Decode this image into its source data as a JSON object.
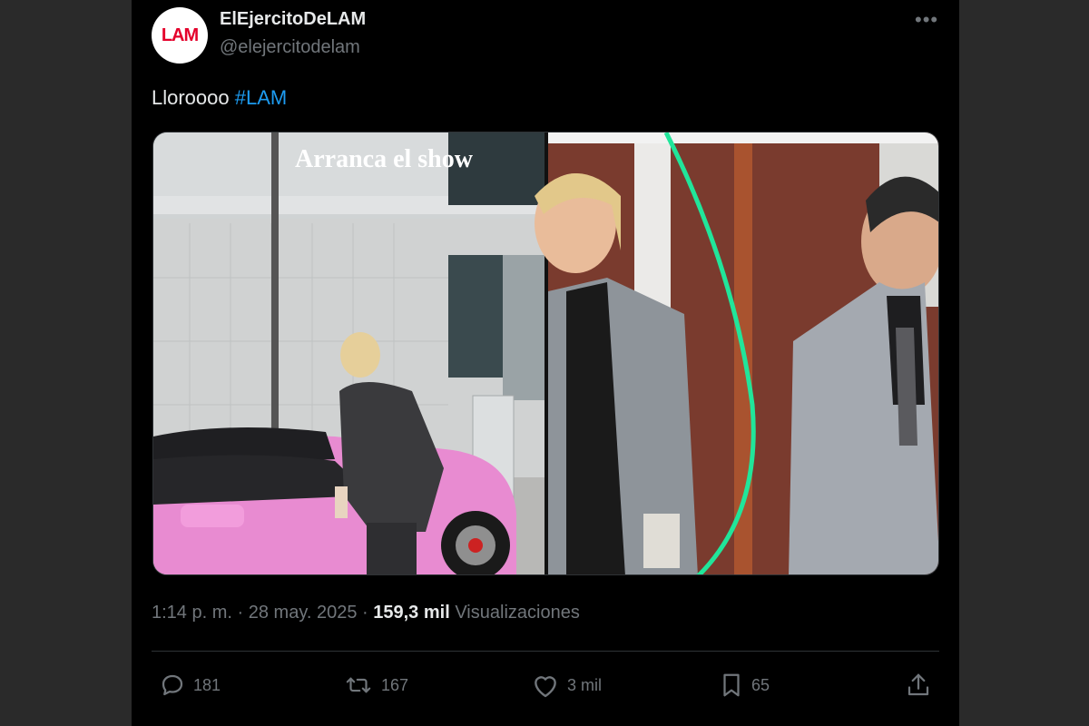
{
  "author": {
    "avatar_text": "LAM",
    "display_name": "ElEjercitoDeLAM",
    "handle": "@elejercitodelam"
  },
  "tweet": {
    "text": "Lloroooo",
    "hashtag": "#LAM"
  },
  "media": {
    "overlay_text": "Arranca el show"
  },
  "meta": {
    "time": "1:14 p. m.",
    "separator": "·",
    "date": "28 may. 2025",
    "separator2": "·",
    "views_count": "159,3 mil",
    "views_label": "Visualizaciones"
  },
  "actions": {
    "replies": "181",
    "reposts": "167",
    "likes": "3 mil",
    "bookmarks": "65"
  },
  "icons": {
    "more": "more-horizontal-icon",
    "reply": "reply-icon",
    "repost": "repost-icon",
    "like": "heart-icon",
    "bookmark": "bookmark-icon",
    "share": "share-icon"
  },
  "colors": {
    "background": "#000000",
    "text": "#e7e9ea",
    "muted": "#71767b",
    "hashtag": "#1d9bf0",
    "brand_logo": "#e4002b"
  }
}
